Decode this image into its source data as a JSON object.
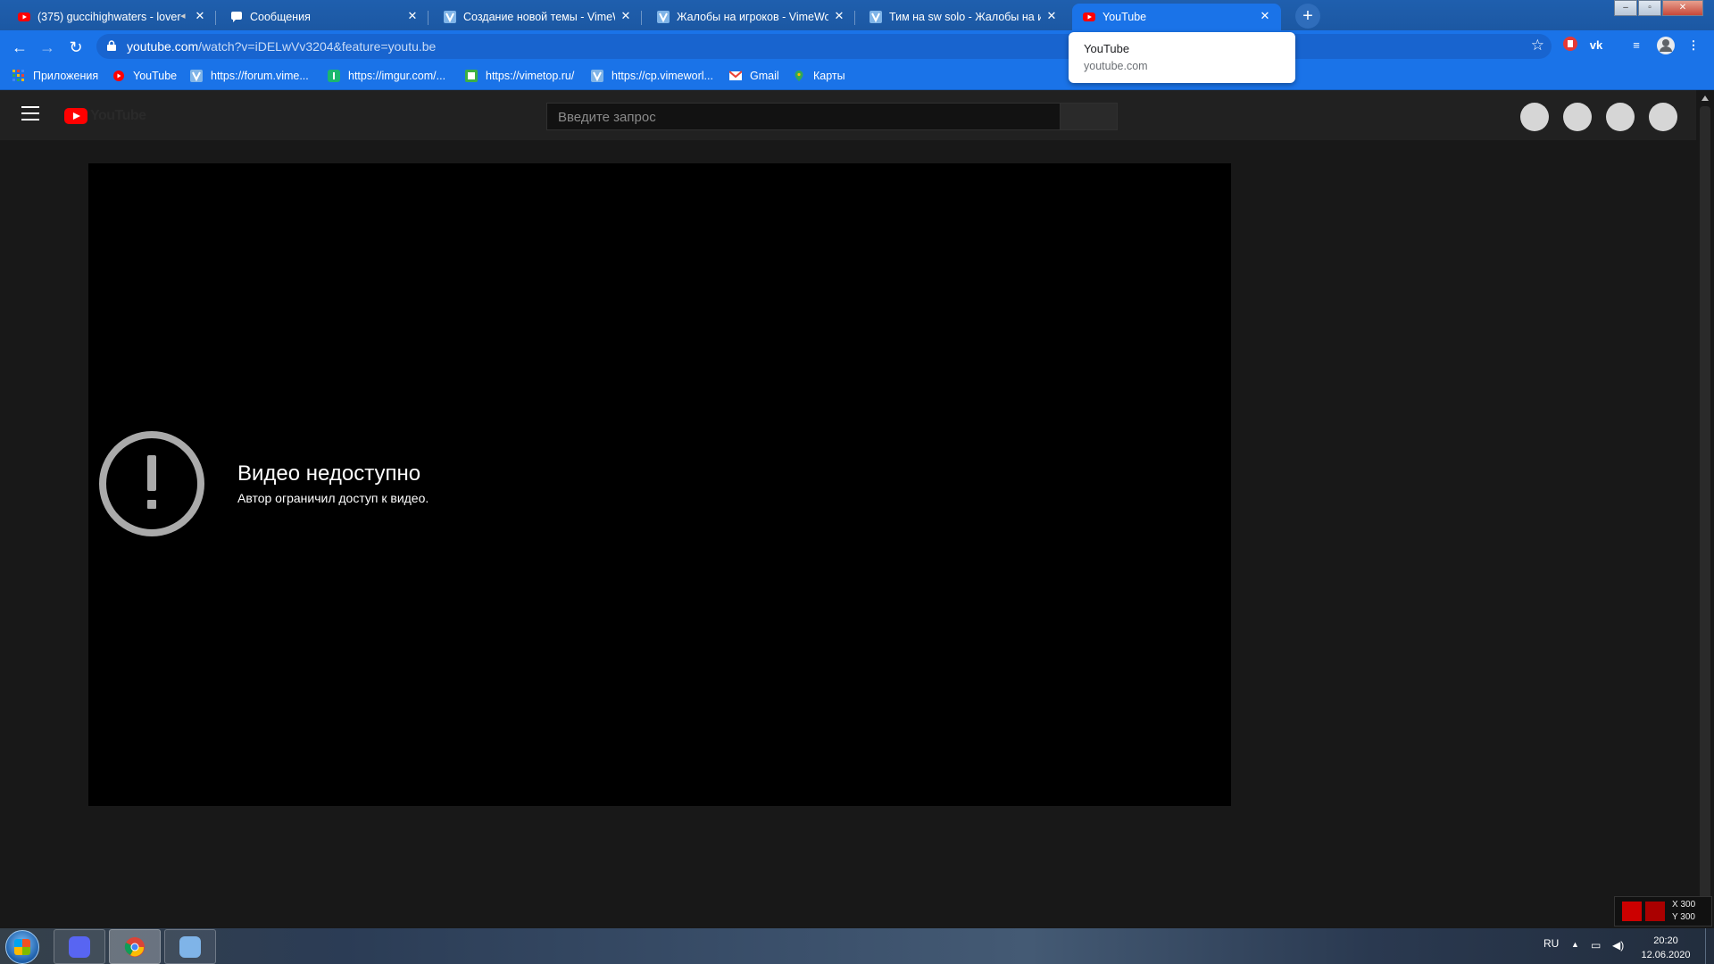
{
  "browser": {
    "tabs": [
      {
        "title": "(375) guccihighwaters - lover",
        "icon": "youtube-icon",
        "muted_icon": "speaker-icon"
      },
      {
        "title": "Сообщения",
        "icon": "chat-icon"
      },
      {
        "title": "Создание новой темы - VimeW",
        "icon": "vimeworld-icon"
      },
      {
        "title": "Жалобы на игроков - VimeWorl",
        "icon": "vimeworld-icon"
      },
      {
        "title": "Тим на sw solo - Жалобы на игр",
        "icon": "vimeworld-icon"
      },
      {
        "title": "YouTube",
        "icon": "youtube-icon",
        "active": true
      }
    ],
    "close_glyph": "✕",
    "new_tab_glyph": "+",
    "url_host": "youtube.com",
    "url_path": "/watch?v=iDELwVv3204&feature=youtu.be",
    "bookmarks": [
      {
        "label": "Приложения",
        "icon": "apps-grid-icon"
      },
      {
        "label": "YouTube",
        "icon": "youtube-icon"
      },
      {
        "label": "https://forum.vime...",
        "icon": "vimeworld-icon"
      },
      {
        "label": "https://imgur.com/...",
        "icon": "imgur-icon"
      },
      {
        "label": "https://vimetop.ru/",
        "icon": "vimetop-icon"
      },
      {
        "label": "https://cp.vimeworl...",
        "icon": "vimeworld-icon"
      },
      {
        "label": "Gmail",
        "icon": "gmail-icon"
      },
      {
        "label": "Карты",
        "icon": "maps-icon"
      }
    ],
    "hover_card": {
      "title": "YouTube",
      "domain": "youtube.com"
    }
  },
  "youtube": {
    "logo_text": "YouTube",
    "search_placeholder": "Введите запрос",
    "error_title": "Видео недоступно",
    "error_subtitle": "Автор ограничил доступ к видео."
  },
  "overlay": {
    "x_readout": "X 300",
    "y_readout": "Y 300"
  },
  "taskbar": {
    "language": "RU",
    "time": "20:20",
    "date": "12.06.2020"
  },
  "colors": {
    "chrome_blue": "#1a73e8",
    "youtube_red": "#ff0000",
    "page_bg": "#181818",
    "player_bg": "#000000"
  }
}
